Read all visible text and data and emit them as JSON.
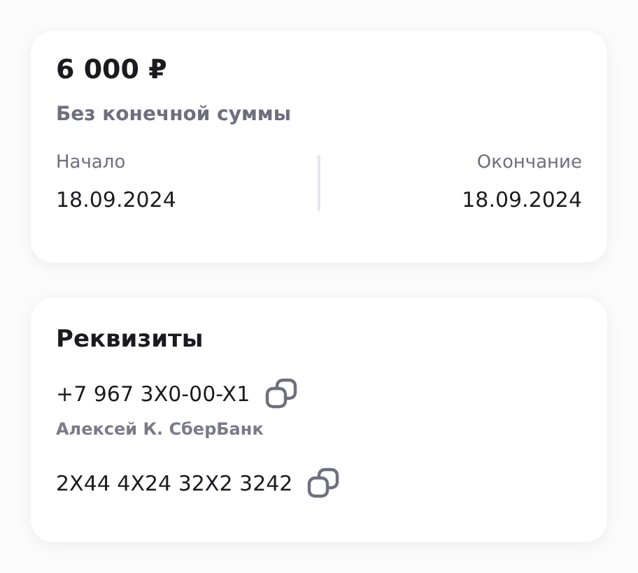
{
  "summary": {
    "amount": "6 000 ₽",
    "subtitle": "Без конечной суммы",
    "dates": [
      {
        "label": "Начало",
        "value": "18.09.2024"
      },
      {
        "label": "Окончание",
        "value": "18.09.2024"
      }
    ]
  },
  "requisites": {
    "title": "Реквизиты",
    "items": [
      {
        "kind": "copyable",
        "text": "+7 967 3X0-00-X1"
      },
      {
        "kind": "caption",
        "text": "Алексей К. СберБанк"
      },
      {
        "kind": "copyable",
        "text": "2X44 4X24 32X2 3242"
      }
    ]
  }
}
